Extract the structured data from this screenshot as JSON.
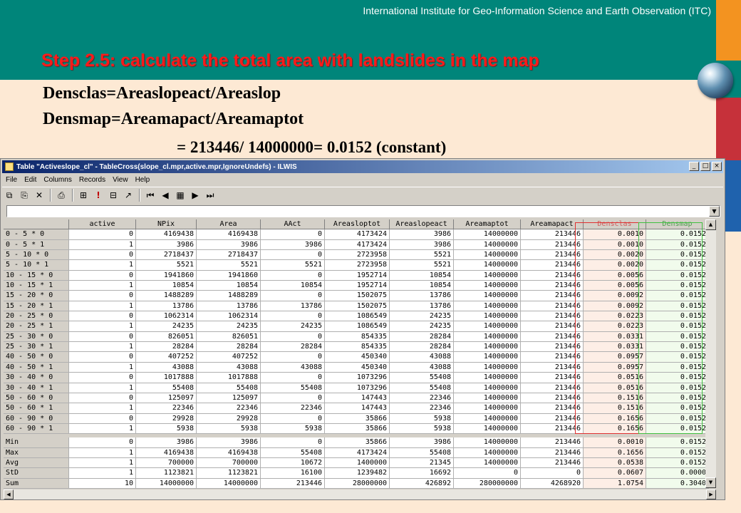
{
  "slide": {
    "institute": "International Institute for Geo-Information Science and Earth Observation (ITC)",
    "step_title": "Step 2.5: calculate the total area with landslides in the map",
    "formula_1": "Densclas=Areaslopeact/Areaslop",
    "formula_2": "Densmap=Areamapact/Areamaptot",
    "formula_3": "= 213446/ 14000000= 0.0152 (constant)"
  },
  "window": {
    "title": "Table \"Activeslope_cl\" - TableCross(slope_cl.mpr,active.mpr,IgnoreUndefs) - ILWIS",
    "buttons": {
      "minimize": "_",
      "maximize": "□",
      "close": "×"
    }
  },
  "menu": [
    "File",
    "Edit",
    "Columns",
    "Records",
    "View",
    "Help"
  ],
  "toolbar": [
    "⧉",
    "⎘",
    "✕",
    "⎙",
    "⊞",
    "!",
    "⊟",
    "↗",
    "⏮",
    "◀",
    "▦",
    "▶",
    "⏭"
  ],
  "table": {
    "columns": [
      "active",
      "NPix",
      "Area",
      "AAct",
      "Areasloptot",
      "Areaslopeact",
      "Areamaptot",
      "Areamapact",
      "Densclas",
      "Densmap"
    ],
    "rows": [
      [
        "0 - 5 * 0",
        "0",
        "4169438",
        "4169438",
        "0",
        "4173424",
        "3986",
        "14000000",
        "213446",
        "0.0010",
        "0.0152"
      ],
      [
        "0 - 5 * 1",
        "1",
        "3986",
        "3986",
        "3986",
        "4173424",
        "3986",
        "14000000",
        "213446",
        "0.0010",
        "0.0152"
      ],
      [
        "5 - 10 * 0",
        "0",
        "2718437",
        "2718437",
        "0",
        "2723958",
        "5521",
        "14000000",
        "213446",
        "0.0020",
        "0.0152"
      ],
      [
        "5 - 10 * 1",
        "1",
        "5521",
        "5521",
        "5521",
        "2723958",
        "5521",
        "14000000",
        "213446",
        "0.0020",
        "0.0152"
      ],
      [
        "10 - 15 * 0",
        "0",
        "1941860",
        "1941860",
        "0",
        "1952714",
        "10854",
        "14000000",
        "213446",
        "0.0056",
        "0.0152"
      ],
      [
        "10 - 15 * 1",
        "1",
        "10854",
        "10854",
        "10854",
        "1952714",
        "10854",
        "14000000",
        "213446",
        "0.0056",
        "0.0152"
      ],
      [
        "15 - 20 * 0",
        "0",
        "1488289",
        "1488289",
        "0",
        "1502075",
        "13786",
        "14000000",
        "213446",
        "0.0092",
        "0.0152"
      ],
      [
        "15 - 20 * 1",
        "1",
        "13786",
        "13786",
        "13786",
        "1502075",
        "13786",
        "14000000",
        "213446",
        "0.0092",
        "0.0152"
      ],
      [
        "20 - 25 * 0",
        "0",
        "1062314",
        "1062314",
        "0",
        "1086549",
        "24235",
        "14000000",
        "213446",
        "0.0223",
        "0.0152"
      ],
      [
        "20 - 25 * 1",
        "1",
        "24235",
        "24235",
        "24235",
        "1086549",
        "24235",
        "14000000",
        "213446",
        "0.0223",
        "0.0152"
      ],
      [
        "25 - 30 * 0",
        "0",
        "826051",
        "826051",
        "0",
        "854335",
        "28284",
        "14000000",
        "213446",
        "0.0331",
        "0.0152"
      ],
      [
        "25 - 30 * 1",
        "1",
        "28284",
        "28284",
        "28284",
        "854335",
        "28284",
        "14000000",
        "213446",
        "0.0331",
        "0.0152"
      ],
      [
        "40 - 50 * 0",
        "0",
        "407252",
        "407252",
        "0",
        "450340",
        "43088",
        "14000000",
        "213446",
        "0.0957",
        "0.0152"
      ],
      [
        "40 - 50 * 1",
        "1",
        "43088",
        "43088",
        "43088",
        "450340",
        "43088",
        "14000000",
        "213446",
        "0.0957",
        "0.0152"
      ],
      [
        "30 - 40 * 0",
        "0",
        "1017888",
        "1017888",
        "0",
        "1073296",
        "55408",
        "14000000",
        "213446",
        "0.0516",
        "0.0152"
      ],
      [
        "30 - 40 * 1",
        "1",
        "55408",
        "55408",
        "55408",
        "1073296",
        "55408",
        "14000000",
        "213446",
        "0.0516",
        "0.0152"
      ],
      [
        "50 - 60 * 0",
        "0",
        "125097",
        "125097",
        "0",
        "147443",
        "22346",
        "14000000",
        "213446",
        "0.1516",
        "0.0152"
      ],
      [
        "50 - 60 * 1",
        "1",
        "22346",
        "22346",
        "22346",
        "147443",
        "22346",
        "14000000",
        "213446",
        "0.1516",
        "0.0152"
      ],
      [
        "60 - 90 * 0",
        "0",
        "29928",
        "29928",
        "0",
        "35866",
        "5938",
        "14000000",
        "213446",
        "0.1656",
        "0.0152"
      ],
      [
        "60 - 90 * 1",
        "1",
        "5938",
        "5938",
        "5938",
        "35866",
        "5938",
        "14000000",
        "213446",
        "0.1656",
        "0.0152"
      ]
    ],
    "stats": [
      [
        "Min",
        "0",
        "3986",
        "3986",
        "0",
        "35866",
        "3986",
        "14000000",
        "213446",
        "0.0010",
        "0.0152"
      ],
      [
        "Max",
        "1",
        "4169438",
        "4169438",
        "55408",
        "4173424",
        "55408",
        "14000000",
        "213446",
        "0.1656",
        "0.0152"
      ],
      [
        "Avg",
        "1",
        "700000",
        "700000",
        "10672",
        "1400000",
        "21345",
        "14000000",
        "213446",
        "0.0538",
        "0.0152"
      ],
      [
        "StD",
        "1",
        "1123821",
        "1123821",
        "16100",
        "1239482",
        "16692",
        "0",
        "0",
        "0.0607",
        "0.0000"
      ],
      [
        "Sum",
        "10",
        "14000000",
        "14000000",
        "213446",
        "28000000",
        "426892",
        "280000000",
        "4268920",
        "1.0754",
        "0.3040"
      ]
    ]
  },
  "colors": {
    "header_teal": "#00857a",
    "title_red": "#ff1a1a",
    "densclas_box": "#e03030",
    "densmap_box": "#40c040"
  }
}
